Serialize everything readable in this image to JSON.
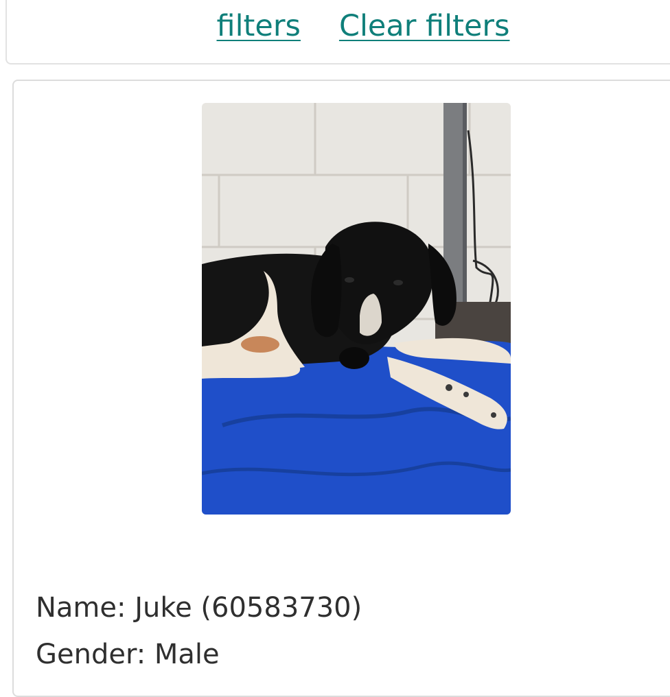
{
  "filters": {
    "apply_label": "filters",
    "clear_label": "Clear filters"
  },
  "pet": {
    "photo_icon": "dog-photo",
    "name_line": "Name: Juke (60583730)",
    "gender_line": "Gender: Male"
  },
  "colors": {
    "link": "#0f7f7a",
    "text": "#2f2f2f",
    "card_border": "#dcdcdc",
    "blanket": "#1f4fc9"
  }
}
